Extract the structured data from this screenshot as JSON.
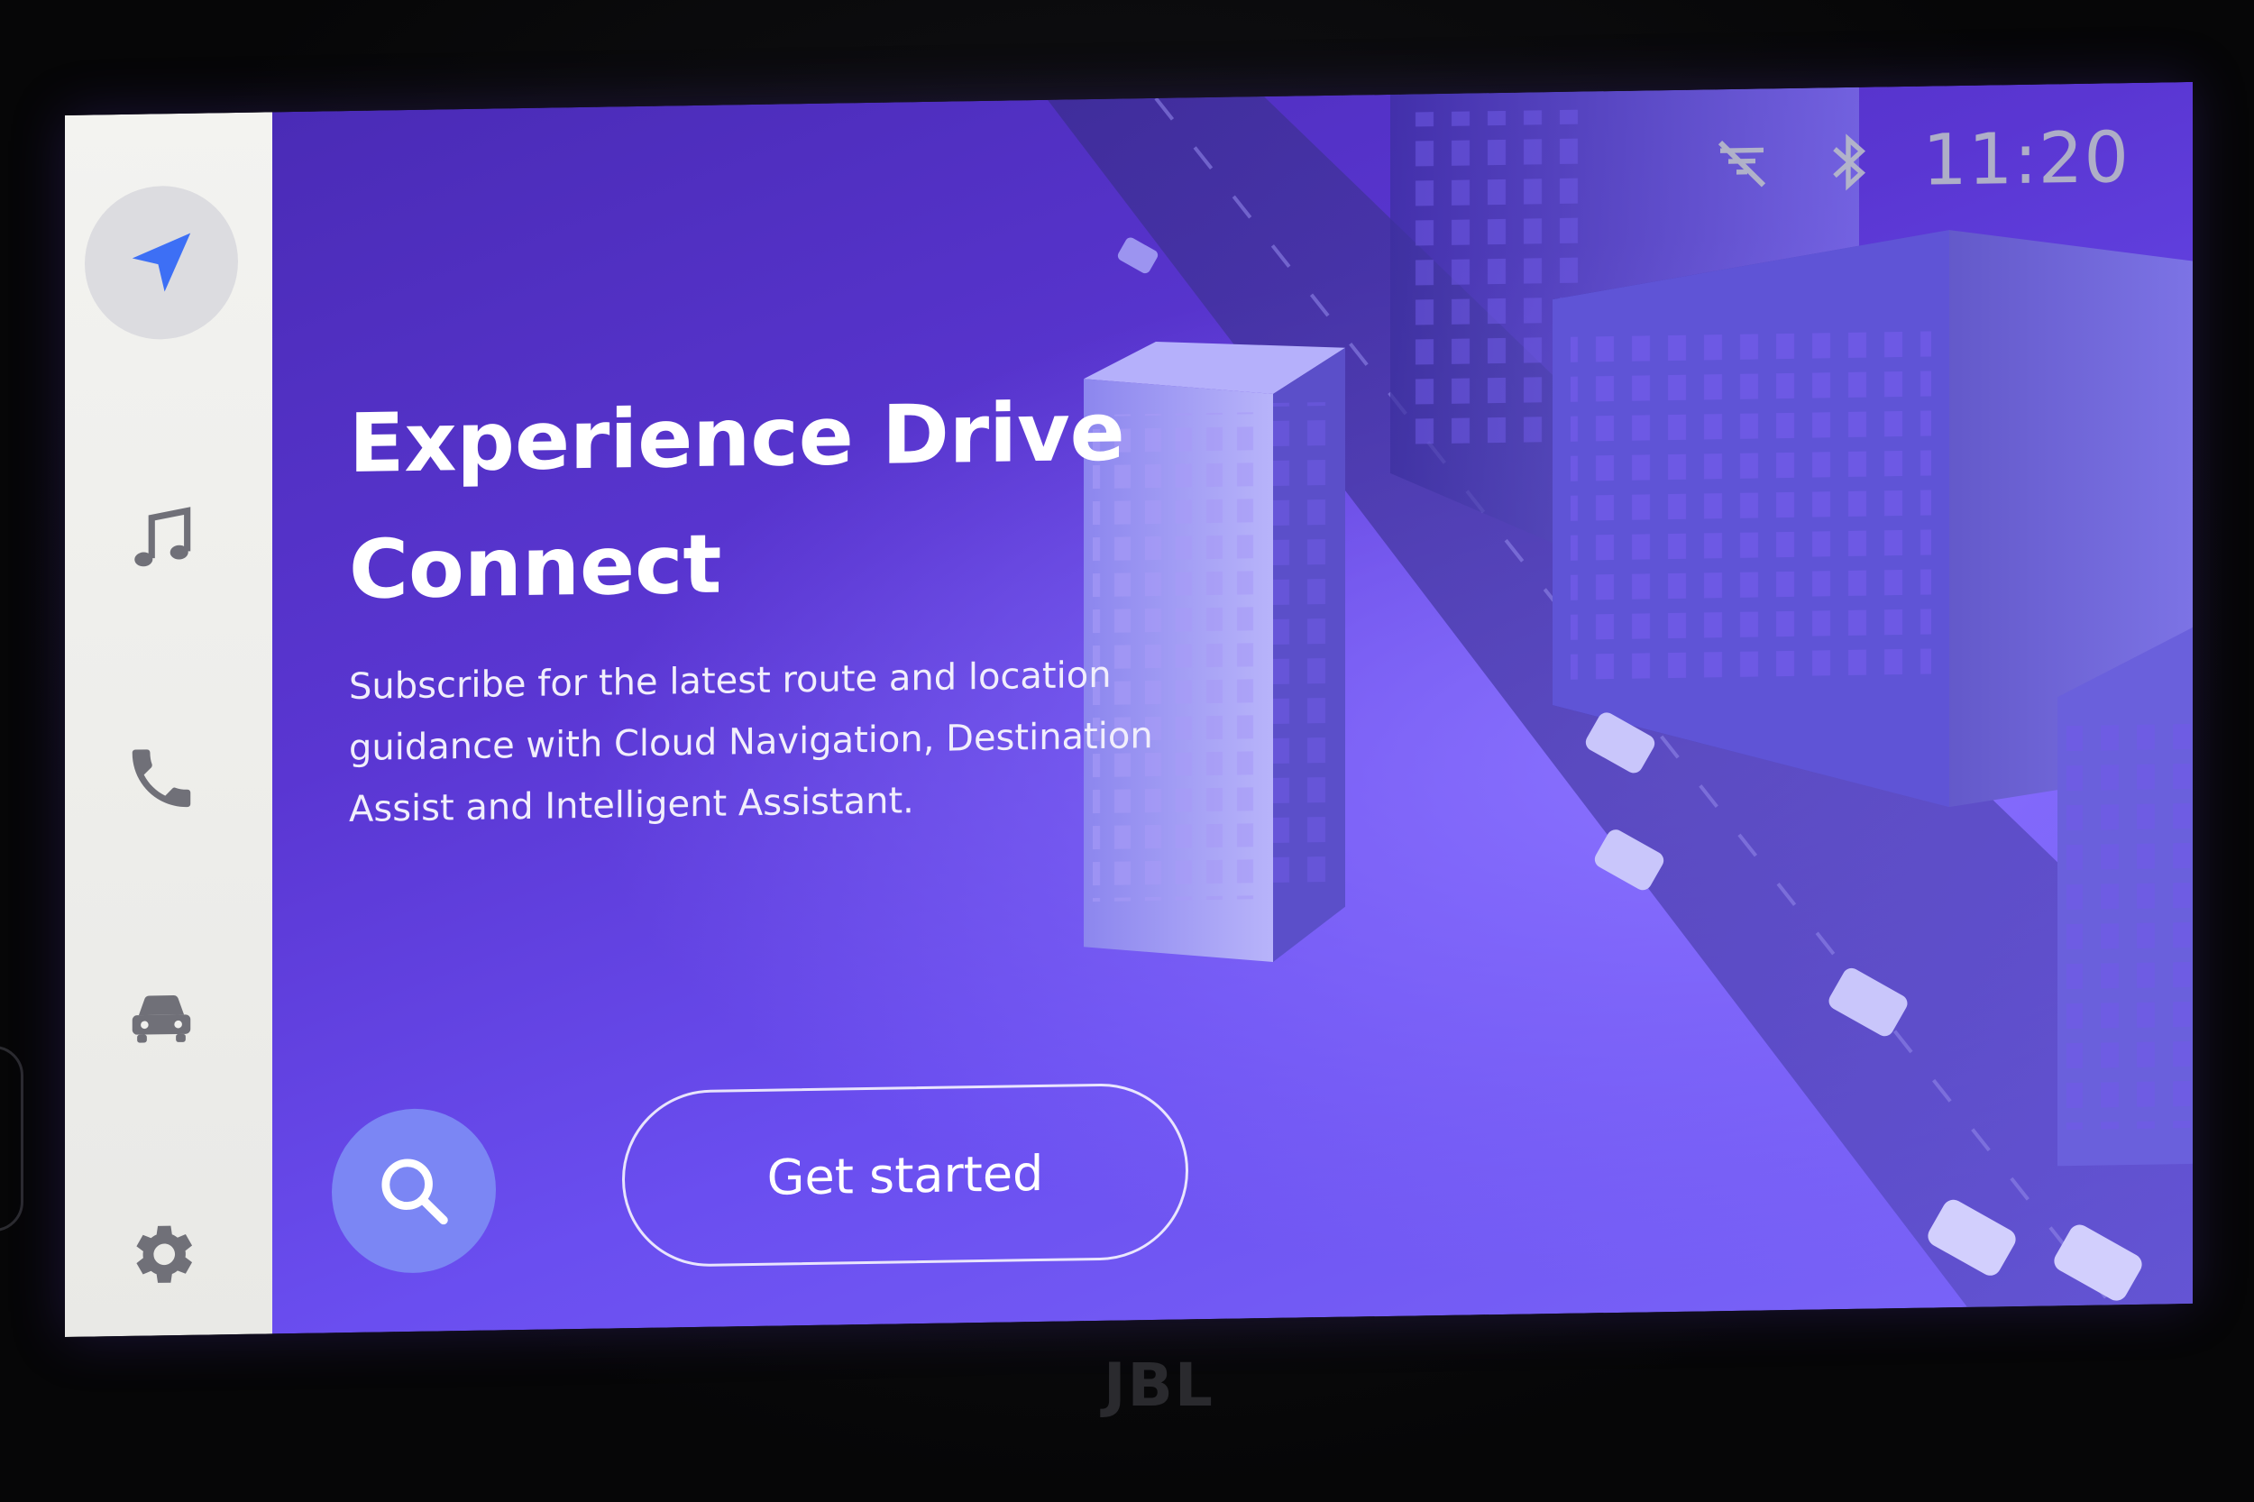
{
  "sidebar": {
    "items": [
      {
        "name": "navigation",
        "icon": "navigation-arrow-icon",
        "active": true
      },
      {
        "name": "music",
        "icon": "music-note-icon",
        "active": false
      },
      {
        "name": "phone",
        "icon": "phone-icon",
        "active": false
      },
      {
        "name": "vehicle",
        "icon": "car-icon",
        "active": false
      },
      {
        "name": "settings",
        "icon": "gear-icon",
        "active": false
      }
    ]
  },
  "status_bar": {
    "time": "11:20",
    "icons": [
      "no-signal-icon",
      "bluetooth-icon"
    ]
  },
  "main": {
    "title_line1": "Experience Drive",
    "title_line2": "Connect",
    "subtitle_line1": "Subscribe for the latest route and location",
    "subtitle_line2": "guidance with Cloud Navigation, Destination",
    "subtitle_line3": "Assist and Intelligent Assistant.",
    "search_icon": "search-icon",
    "cta_label": "Get started"
  },
  "bezel": {
    "brand": "JBL"
  },
  "colors": {
    "accent": "#3d6ff5",
    "sidebar_bg": "#f0f0ee",
    "search_button": "#7b86f4",
    "content_gradient_start": "#4a2bb6",
    "content_gradient_end": "#7b66f8"
  }
}
